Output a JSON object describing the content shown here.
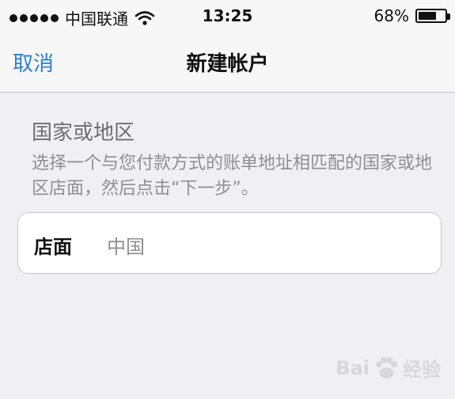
{
  "status_bar": {
    "carrier": "中国联通",
    "time": "13:25",
    "battery_percent": "68%",
    "battery_level": 0.68,
    "signal_icon": "signal-dots-icon",
    "wifi_icon": "wifi-icon"
  },
  "nav": {
    "cancel_label": "取消",
    "title": "新建帐户"
  },
  "section": {
    "title": "国家或地区",
    "description": "选择一个与您付款方式的账单地址相匹配的国家或地区店面，然后点击“下一步”。"
  },
  "store": {
    "label": "店面",
    "value": "中国"
  },
  "watermark": {
    "text": "Bai",
    "text2": "经验"
  }
}
